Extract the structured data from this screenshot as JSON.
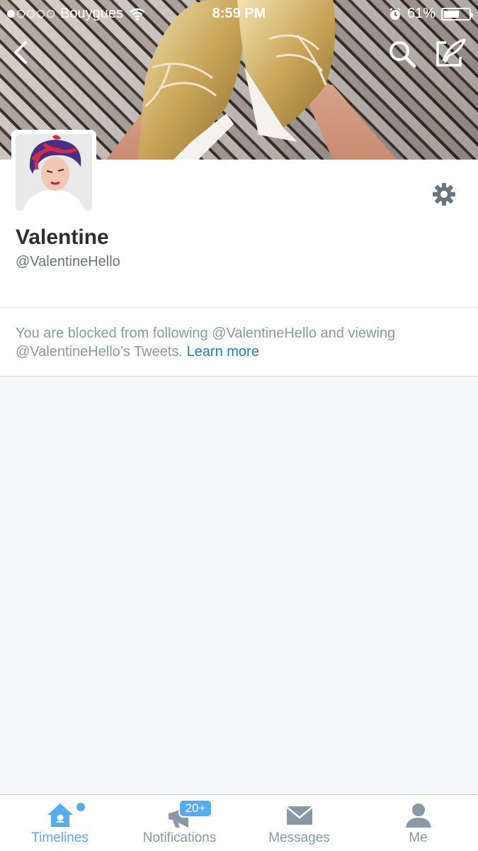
{
  "status_bar": {
    "carrier": "Bouygues",
    "time": "8:59 PM",
    "battery_percent": "61%",
    "battery_level": 0.61,
    "signal_bars_filled": 1,
    "signal_bars_total": 5
  },
  "header": {
    "back_icon": "chevron-left-icon",
    "search_icon": "search-icon",
    "compose_icon": "compose-tweet-icon"
  },
  "profile": {
    "display_name": "Valentine",
    "handle": "@ValentineHello",
    "settings_icon": "gear-icon"
  },
  "notice": {
    "text": "You are blocked from following @ValentineHello and viewing @ValentineHello’s Tweets.",
    "link": "Learn more"
  },
  "tabs": [
    {
      "label": "Timelines",
      "icon": "home-icon",
      "active": true
    },
    {
      "label": "Notifications",
      "icon": "megaphone-icon",
      "active": false
    },
    {
      "label": "Messages",
      "icon": "envelope-icon",
      "active": false
    },
    {
      "label": "Me",
      "icon": "person-icon",
      "active": false
    }
  ],
  "notifications_badge": "20+",
  "colors": {
    "accent": "#55acee",
    "link": "#2b7bb9",
    "text_primary": "#292f33",
    "text_secondary": "#8899a6",
    "background": "#f5f8fa"
  }
}
